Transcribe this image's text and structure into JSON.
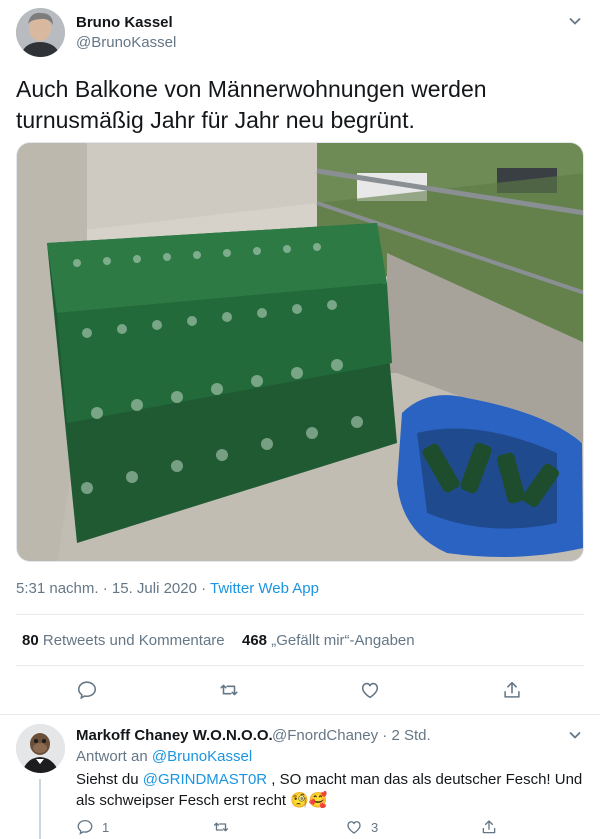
{
  "tweet": {
    "author_name": "Bruno Kassel",
    "author_handle": "@BrunoKassel",
    "text": "Auch Balkone von Männerwohnungen werden\nturnusmäßig Jahr für Jahr neu begrünt.",
    "time": "5:31 nachm. · 15. Juli 2020 · ",
    "source": "Twitter Web App",
    "retweets_count": "80",
    "retweets_label": "Retweets und Kommentare",
    "likes_count": "468",
    "likes_label": "„Gefällt mir“-Angaben",
    "photo_icon": "photo-balcony-bottles"
  },
  "reply": {
    "author_name": "Markoff Chaney W.O.N.O.O.",
    "author_handle": "@FnordChaney · 2 Std.",
    "reply_prefix": "Antwort an ",
    "reply_to": "@BrunoKassel",
    "text_before": "Siehst du ",
    "mention": "@GRINDMAST0R",
    "text_after": " , SO macht man das als deutscher Fesch! Und als schweipser Fesch erst recht ",
    "emoji": "🧐🥰",
    "reply_count": "1",
    "like_count": "3"
  },
  "colors": {
    "accent": "#1b95e0",
    "text": "#14171a",
    "muted": "#657786",
    "border": "#e6ecf0"
  }
}
